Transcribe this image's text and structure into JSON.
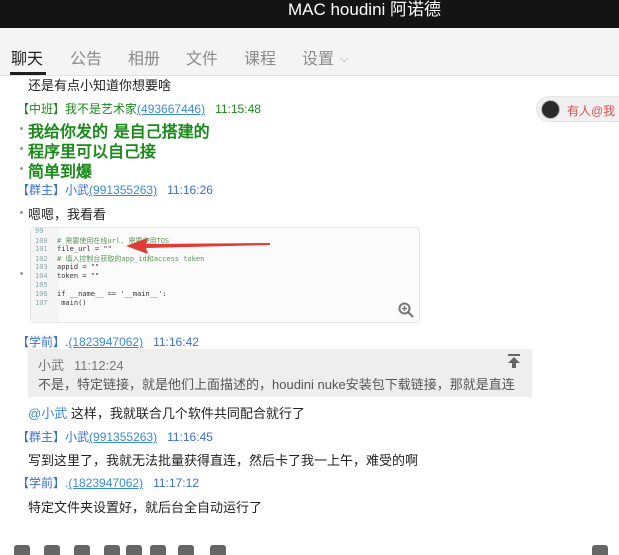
{
  "window": {
    "title": "MAC houdini 阿诺德"
  },
  "tabs": [
    {
      "label": "聊天"
    },
    {
      "label": "公告"
    },
    {
      "label": "相册"
    },
    {
      "label": "文件"
    },
    {
      "label": "课程"
    },
    {
      "label": "设置"
    }
  ],
  "mention_badge": {
    "label": "有人@我"
  },
  "messages": {
    "m0": {
      "text": "还是有点小知道你想要啥"
    },
    "m1": {
      "role": "【中班】",
      "name": "我不是艺术家",
      "id": "(493667446)",
      "time": "11:15:48",
      "lines": [
        "我给你发的 是自己搭建的",
        "程序里可以自己接",
        "简单到爆"
      ]
    },
    "m2": {
      "role": "【群主】",
      "name": "小武",
      "id": "(991355263)",
      "time": "11:16:26",
      "text": "嗯嗯，我看看"
    },
    "m2img": {
      "lines": [
        {
          "no": "99",
          "code": ""
        },
        {
          "no": "100",
          "code": "# 需要使用在线url, 需要使用TOS"
        },
        {
          "no": "101",
          "code": "file_url = \"\""
        },
        {
          "no": "102",
          "code": "# 填入控制台获取的app_id和access token"
        },
        {
          "no": "103",
          "code": "appid = \"\""
        },
        {
          "no": "104",
          "code": "token = \"\""
        },
        {
          "no": "105",
          "code": ""
        },
        {
          "no": "106",
          "code": "if __name__ == '__main__':"
        },
        {
          "no": "107",
          "code": "    main()"
        }
      ]
    },
    "m3": {
      "role": "【学前】",
      "name": ".",
      "id": "(1823947062)",
      "time": "11:16:42",
      "quote_name": "小武",
      "quote_time": "11:12:24",
      "quote_text": "不是，特定链接，就是他们上面描述的，houdini nuke安装包下载链接，那就是直连",
      "at": "@小武",
      "text": " 这样，我就联合几个软件共同配合就行了"
    },
    "m4": {
      "role": "【群主】",
      "name": "小武",
      "id": "(991355263)",
      "time": "11:16:45",
      "text": "写到这里了，我就无法批量获得直连，然后卡了我一上午，难受的啊"
    },
    "m5": {
      "role": "【学前】",
      "name": ".",
      "id": "(1823947062)",
      "time": "11:17:12",
      "text": "特定文件夹设置好，就后台全自动运行了"
    }
  },
  "colors": {
    "green": "#1a8a1a",
    "blue": "#3a8bd6",
    "link": "#3a8bd6",
    "title_bg": "#141414"
  }
}
